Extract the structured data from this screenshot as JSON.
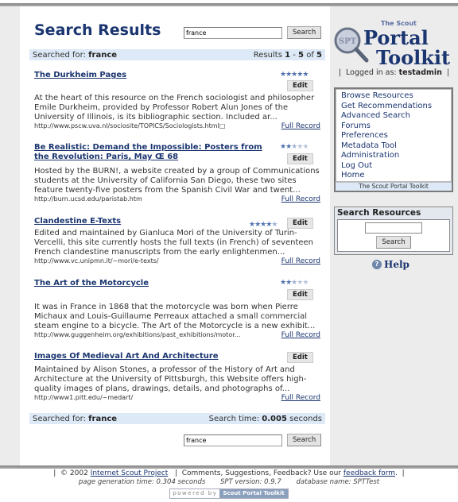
{
  "header": {
    "title": "Search Results",
    "search_value": "france",
    "search_button": "Search"
  },
  "top_bar": {
    "searched_for_label": "Searched for:",
    "query": "france",
    "results_prefix": "Results",
    "range_start": "1",
    "range_sep": "-",
    "range_end": "5",
    "of_label": "of",
    "total": "5"
  },
  "results": [
    {
      "title": "The Durkheim Pages",
      "rating": 5,
      "rating_max": 5,
      "edit_label": "Edit",
      "description": "At the heart of this resource on the French sociologist and philosopher Emile Durkheim, provided by Professor Robert Alun Jones of the University of Illinois, is its bibliographic section. Included ar...",
      "url": "http://www.pscw.uva.nl/sociosite/TOPICS/Sociologists.html□",
      "full_record": "Full Record"
    },
    {
      "title": "Be Realistic: Demand the Impossible: Posters from the Revolution: Paris, May Œ 68",
      "rating": 2.5,
      "rating_max": 5,
      "edit_label": "Edit",
      "description": "Hosted by the BURN!, a website created by a group of Communications students at the University of California San Diego, these two sites feature twenty-five posters from the Spanish Civil War and twent...",
      "url": "http://burn.ucsd.edu/paristab.htm",
      "full_record": "Full Record"
    },
    {
      "title": "Clandestine E-Texts",
      "rating": 4.5,
      "rating_max": 5,
      "edit_label": "Edit",
      "description": "Edited and maintained by Gianluca Mori of the University of Turin-Vercelli, this site currently hosts the full texts (in French) of seventeen French clandestine manuscripts from the early enlightenmen...",
      "url": "http://www.vc.unipmn.it/~mori/e-texts/",
      "full_record": "Full Record"
    },
    {
      "title": "The Art of the Motorcycle",
      "rating": 2.5,
      "rating_max": 5,
      "edit_label": "Edit",
      "description": "It was in France in 1868 that the motorcycle was born when Pierre Michaux and Louis-Guillaume Perreaux attached a small commercial steam engine to a bicycle. The Art of the Motorcycle is a new exhibit...",
      "url": "http://www.guggenheim.org/exhibitions/past_exhibitions/motor...",
      "full_record": "Full Record"
    },
    {
      "title": "Images Of Medieval Art And Architecture",
      "rating": null,
      "rating_max": 5,
      "edit_label": "Edit",
      "description": "Maintained by Alison Stones, a professor of the History of Art and Architecture at the University of Pittsburgh, this Website offers high-quality images of plans, drawings, details, and photographs of...",
      "url": "http://www1.pitt.edu/~medart/",
      "full_record": "Full Record"
    }
  ],
  "bottom_bar": {
    "searched_for_label": "Searched for:",
    "query": "france",
    "search_time_label": "Search time:",
    "search_time": "0.005",
    "seconds_label": "seconds"
  },
  "bottom_search": {
    "search_value": "france",
    "search_button": "Search"
  },
  "sidebar": {
    "logo": {
      "small": "The Scout",
      "line1": "Portal",
      "line2": "Toolkit",
      "badge": "SPT"
    },
    "logged_in_label": "Logged in as:",
    "username": "testadmin",
    "nav_items": [
      "Browse Resources",
      "Get Recommendations",
      "Advanced Search",
      "Forums",
      "Preferences",
      "Metadata Tool",
      "Administration",
      "Log Out",
      "Home"
    ],
    "nav_footer": "The Scout Portal Toolkit",
    "search_box_title": "Search Resources",
    "search_box_value": "",
    "search_box_button": "Search",
    "help_label": "Help",
    "help_icon": "question-circle-icon"
  },
  "footer": {
    "copyright": "© 2002",
    "org_link": "Internet Scout Project",
    "comments_text": "Comments, Suggestions, Feedback? Use our",
    "feedback_link": "feedback form",
    "generation_time": "page generation time: 0.304 seconds",
    "spt_version": "SPT version: 0.9.7",
    "database_name": "database name: SPTTest",
    "powered_by": "powered by",
    "powered_name": "Scout Portal Toolkit"
  },
  "colors": {
    "brand_blue": "#1a3570",
    "info_bar": "#dde9f7",
    "sidebar_bg": "#ececec",
    "star": "#5072b0"
  }
}
